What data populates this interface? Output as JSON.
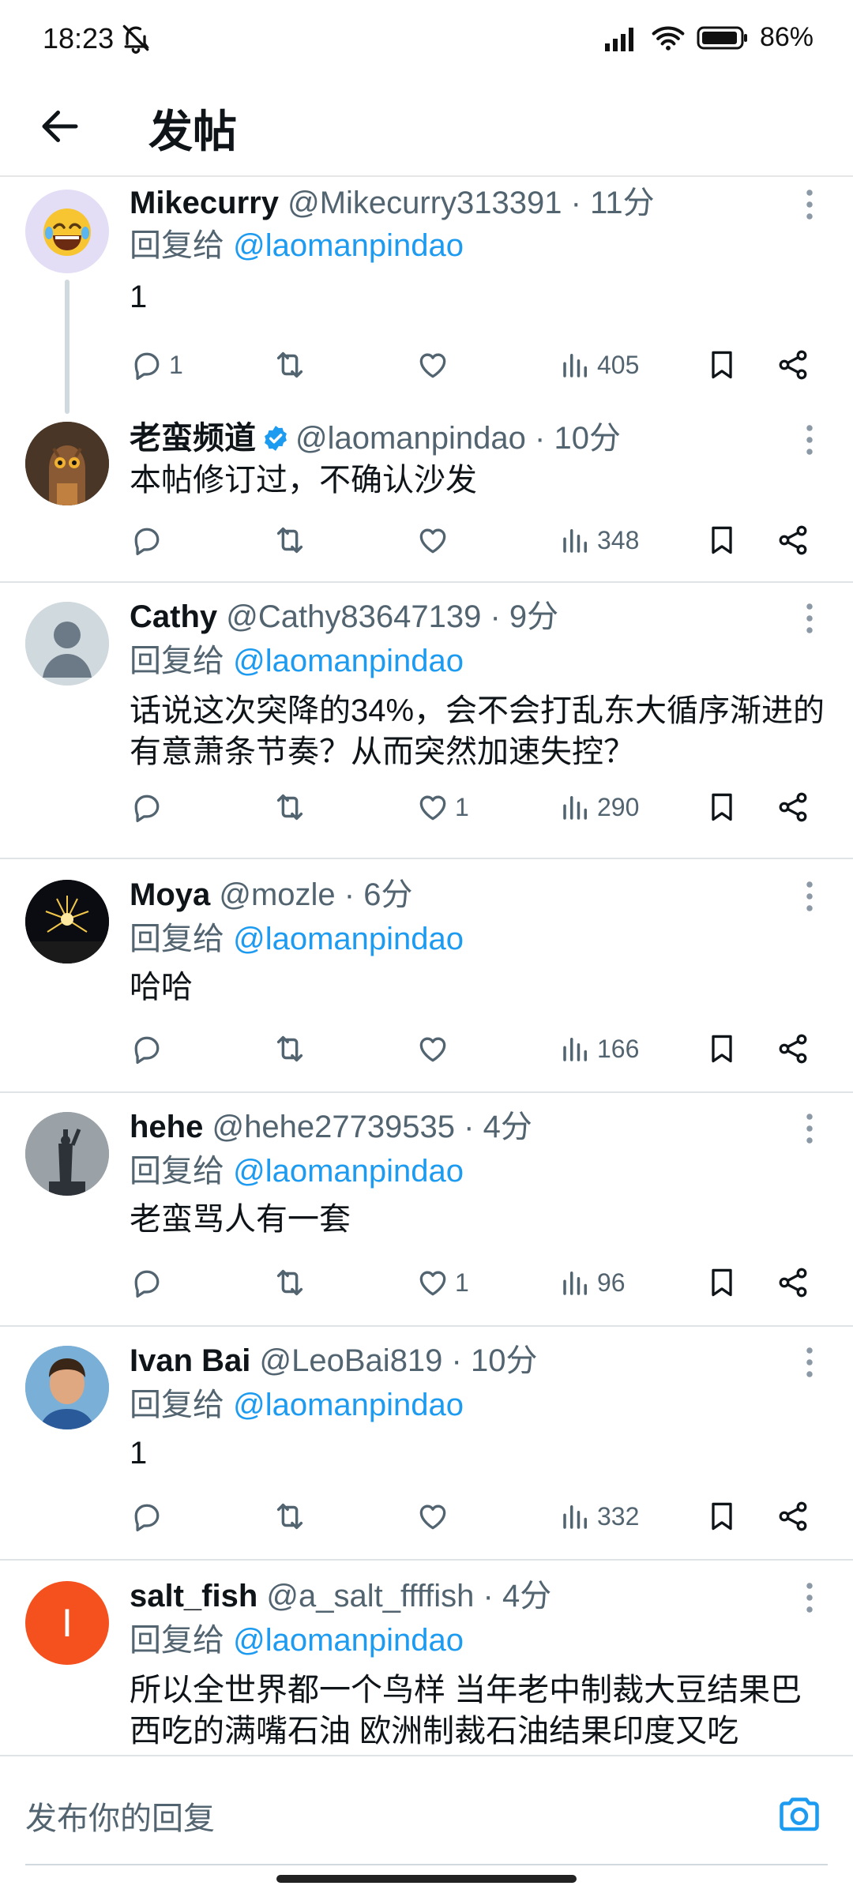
{
  "status": {
    "time": "18:23",
    "battery": "86%"
  },
  "header": {
    "title": "发帖"
  },
  "tweets": [
    {
      "name": "Mikecurry",
      "handle": "@Mikecurry313391 · 11分",
      "reply_prefix": "回复给",
      "reply_mention": "@laomanpindao",
      "text": "1",
      "counts": {
        "replies": "1",
        "retweets": "",
        "likes": "",
        "views": "405"
      }
    },
    {
      "name": "老蛮频道",
      "handle": "@laomanpindao · 10分",
      "verified": true,
      "text": "本帖修订过，不确认沙发",
      "counts": {
        "replies": "",
        "retweets": "",
        "likes": "",
        "views": "348"
      }
    },
    {
      "name": "Cathy",
      "handle": "@Cathy83647139 · 9分",
      "reply_prefix": "回复给",
      "reply_mention": "@laomanpindao",
      "text": "话说这次突降的34%，会不会打乱东大循序渐进的有意萧条节奏？从而突然加速失控？",
      "counts": {
        "replies": "",
        "retweets": "",
        "likes": "1",
        "views": "290"
      }
    },
    {
      "name": "Moya",
      "handle": "@mozle · 6分",
      "reply_prefix": "回复给",
      "reply_mention": "@laomanpindao",
      "text": "哈哈",
      "counts": {
        "replies": "",
        "retweets": "",
        "likes": "",
        "views": "166"
      }
    },
    {
      "name": "hehe",
      "handle": "@hehe27739535 · 4分",
      "reply_prefix": "回复给",
      "reply_mention": "@laomanpindao",
      "text": "老蛮骂人有一套",
      "counts": {
        "replies": "",
        "retweets": "",
        "likes": "1",
        "views": "96"
      }
    },
    {
      "name": "Ivan Bai",
      "handle": "@LeoBai819 · 10分",
      "reply_prefix": "回复给",
      "reply_mention": "@laomanpindao",
      "text": "1",
      "counts": {
        "replies": "",
        "retweets": "",
        "likes": "",
        "views": "332"
      }
    },
    {
      "name": "salt_fish",
      "handle": "@a_salt_ffffish · 4分",
      "reply_prefix": "回复给",
      "reply_mention": "@laomanpindao",
      "avatar_letter": "I",
      "text": "所以全世界都一个鸟样 当年老中制裁大豆结果巴西吃的满嘴石油 欧洲制裁石油结果印度又吃"
    }
  ],
  "composer": {
    "placeholder": "发布你的回复"
  },
  "colors": {
    "accent": "#1d9bf0",
    "text": "#0f1419",
    "muted": "#536471"
  },
  "icons": [
    "back-arrow-icon",
    "reply-icon",
    "retweet-icon",
    "like-icon",
    "views-icon",
    "bookmark-icon",
    "share-icon",
    "more-icon",
    "verified-icon",
    "camera-icon"
  ]
}
